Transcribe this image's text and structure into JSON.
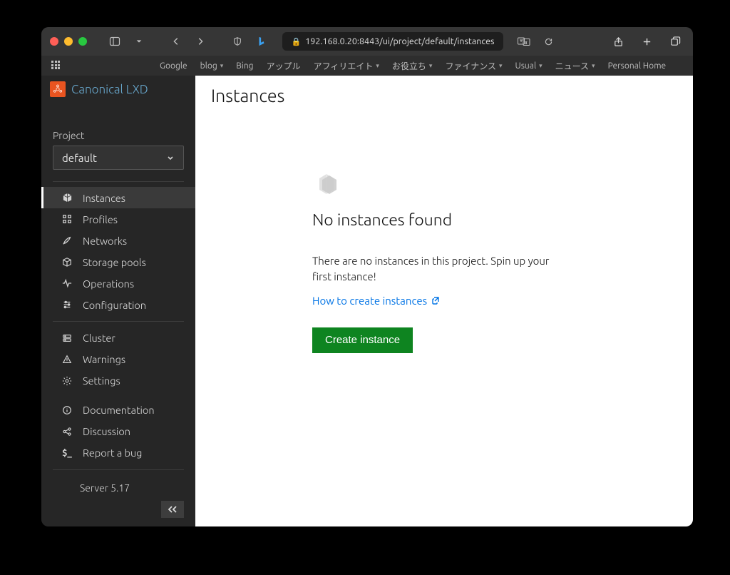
{
  "browser": {
    "url": "192.168.0.20:8443/ui/project/default/instances",
    "bookmarks": [
      "Google",
      "blog",
      "Bing",
      "アップル",
      "アフィリエイト",
      "お役立ち",
      "ファイナンス",
      "Usual",
      "ニュース",
      "Personal Home"
    ],
    "bookmark_has_dropdown": [
      false,
      true,
      false,
      false,
      true,
      true,
      true,
      true,
      true,
      false
    ]
  },
  "brand": {
    "title": "Canonical LXD"
  },
  "project": {
    "label": "Project",
    "selected": "default"
  },
  "nav_main": [
    {
      "label": "Instances",
      "icon": "cube-icon"
    },
    {
      "label": "Profiles",
      "icon": "grid-icon"
    },
    {
      "label": "Networks",
      "icon": "brush-icon"
    },
    {
      "label": "Storage pools",
      "icon": "package-icon"
    },
    {
      "label": "Operations",
      "icon": "activity-icon"
    },
    {
      "label": "Configuration",
      "icon": "sliders-icon"
    }
  ],
  "nav_cluster": [
    {
      "label": "Cluster",
      "icon": "server-icon"
    },
    {
      "label": "Warnings",
      "icon": "warning-icon"
    },
    {
      "label": "Settings",
      "icon": "gear-icon"
    }
  ],
  "nav_help": [
    {
      "label": "Documentation",
      "icon": "info-icon"
    },
    {
      "label": "Discussion",
      "icon": "share-icon"
    },
    {
      "label": "Report a bug",
      "icon": "bug-icon"
    }
  ],
  "server_version": "Server 5.17",
  "page": {
    "title": "Instances",
    "empty_heading": "No instances found",
    "empty_text": "There are no instances in this project. Spin up your first instance!",
    "help_link": "How to create instances",
    "create_button": "Create instance"
  }
}
